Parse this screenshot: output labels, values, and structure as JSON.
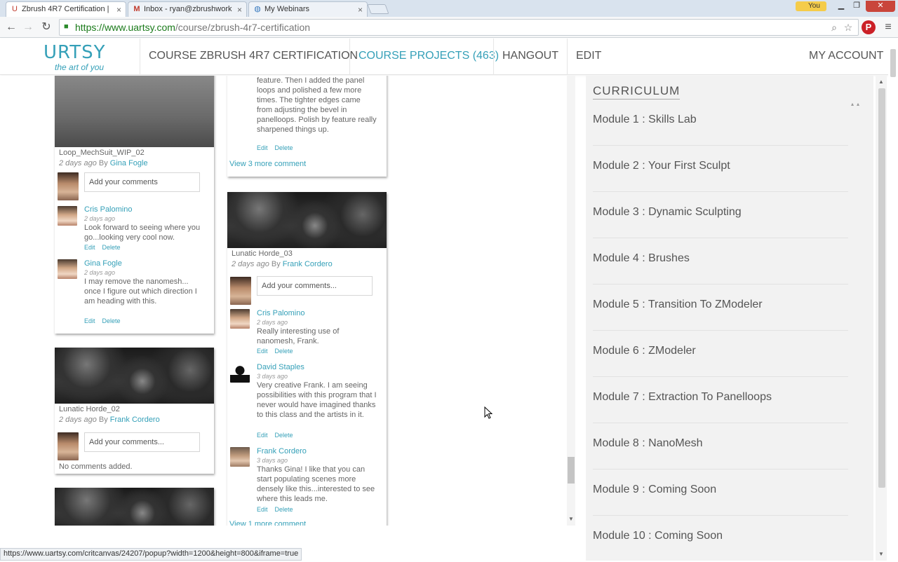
{
  "browser": {
    "tabs": [
      {
        "title": "Zbrush 4R7 Certification |",
        "icon": "urtsy-icon",
        "active": true
      },
      {
        "title": "Inbox - ryan@zbrushwork",
        "icon": "gmail-icon",
        "active": false
      },
      {
        "title": "My Webinars",
        "icon": "globe-icon",
        "active": false
      }
    ],
    "user_badge": "You",
    "url_host": "https://www.uartsy.com",
    "url_path": "/course/zbrush-4r7-certification"
  },
  "site": {
    "logo_word": "URTSY",
    "logo_tagline": "the art of you",
    "nav": {
      "course": "COURSE ZBRUSH 4R7 CERTIFICATION",
      "projects": "COURSE PROJECTS (463)",
      "hangout": "HANGOUT",
      "edit": "EDIT",
      "account": "MY ACCOUNT"
    },
    "accent_color": "#35a0b8"
  },
  "cards": {
    "col1_top": {
      "title": "Loop_MechSuit_WIP_02",
      "time": "2 days ago",
      "by": "By",
      "author": "Gina Fogle",
      "comment_placeholder": "Add your comments",
      "comments": [
        {
          "name": "Cris Palomino",
          "date": "2 days ago",
          "text": "Look forward to seeing where you go...looking very cool now.",
          "edit": "Edit",
          "delete": "Delete"
        },
        {
          "name": "Gina Fogle",
          "date": "2 days ago",
          "text": "I may remove the nanomesh... once I figure out which direction I am heading with this.",
          "edit": "Edit",
          "delete": "Delete"
        }
      ]
    },
    "col2_top": {
      "text_tail": "feature. Then I added the panel loops and polished a few more times. The tighter edges came from adjusting the bevel in panelloops. Polish by feature really sharpened things up.",
      "edit": "Edit",
      "delete": "Delete",
      "view_more": "View 3 more comment"
    },
    "col1_mid": {
      "title": "Lunatic Horde_02",
      "time": "2 days ago",
      "by": "By",
      "author": "Frank Cordero",
      "comment_placeholder": "Add your comments...",
      "no_comments": "No comments added."
    },
    "col2_mid": {
      "title": "Lunatic Horde_03",
      "time": "2 days ago",
      "by": "By",
      "author": "Frank Cordero",
      "comment_placeholder": "Add your comments...",
      "comments": [
        {
          "name": "Cris Palomino",
          "date": "2 days ago",
          "text": "Really interesting use of nanomesh, Frank.",
          "edit": "Edit",
          "delete": "Delete"
        },
        {
          "name": "David Staples",
          "date": "3 days ago",
          "text": "Very creative Frank. I am seeing possibilities with this program that I never would have imagined thanks to this class and the artists in it.",
          "edit": "Edit",
          "delete": "Delete"
        },
        {
          "name": "Frank Cordero",
          "date": "3 days ago",
          "text": "Thanks Gina! I like that you can start populating scenes more densely like this...interested to see where this leads me.",
          "edit": "Edit",
          "delete": "Delete"
        }
      ],
      "view_more": "View 1 more comment"
    }
  },
  "curriculum": {
    "heading": "CURRICULUM",
    "modules": [
      "Module 1 : Skills Lab",
      "Module 2 : Your First Sculpt",
      "Module 3 : Dynamic Sculpting",
      "Module 4 : Brushes",
      "Module 5 : Transition To ZModeler",
      "Module 6 : ZModeler",
      "Module 7 : Extraction To Panelloops",
      "Module 8 : NanoMesh",
      "Module 9 : Coming Soon",
      "Module 10 : Coming Soon"
    ]
  },
  "status_url": "https://www.uartsy.com/critcanvas/24207/popup?width=1200&height=800&iframe=true"
}
